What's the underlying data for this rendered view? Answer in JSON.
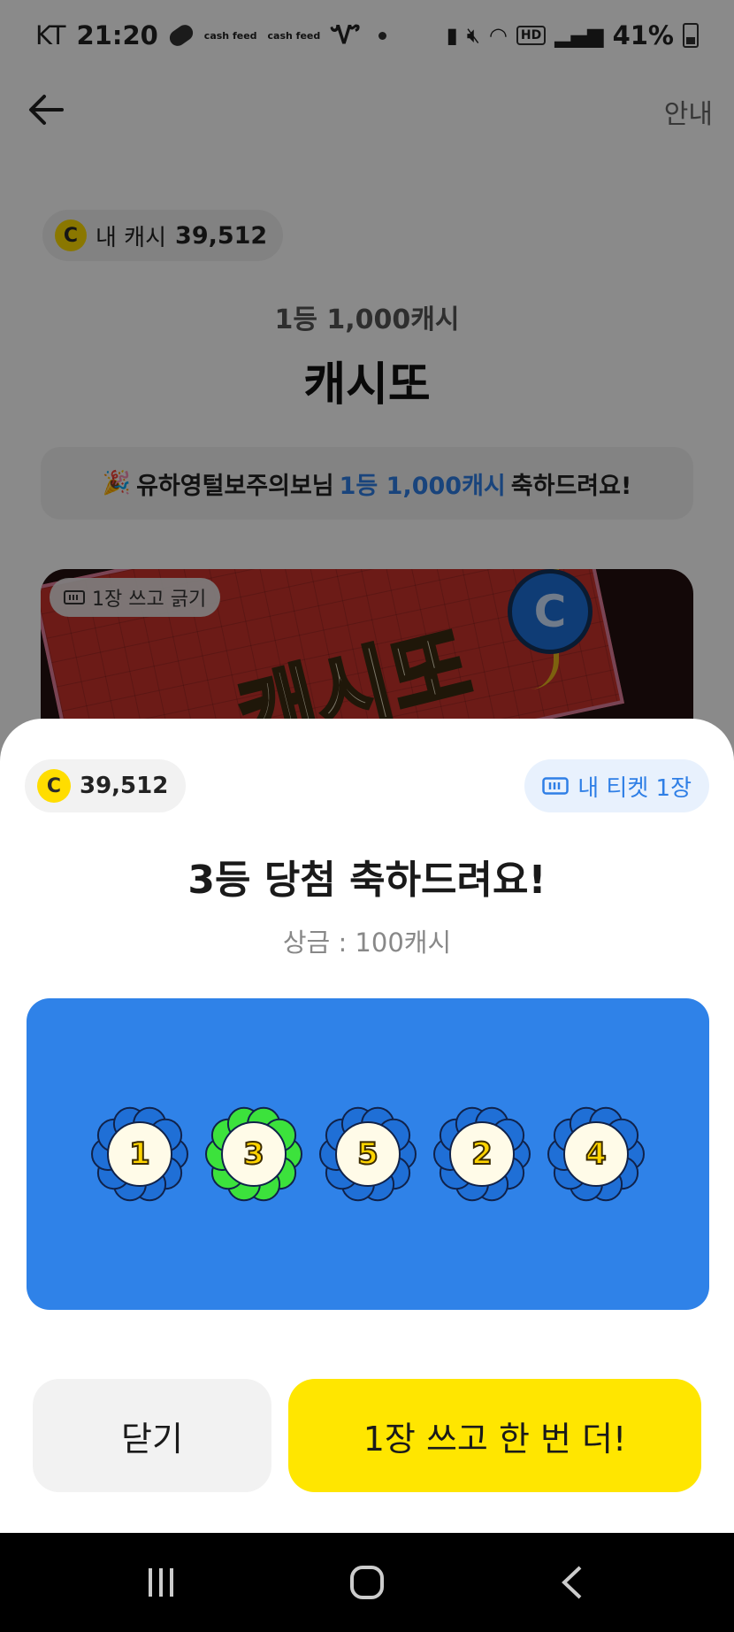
{
  "status_bar": {
    "carrier": "KT",
    "time": "21:20",
    "app_badges": [
      "cash feed",
      "cash feed"
    ],
    "battery": "41%"
  },
  "nav": {
    "info_label": "안내"
  },
  "my_cash": {
    "label": "내 캐시",
    "value": "39,512",
    "coin_letter": "C"
  },
  "game": {
    "top_prize": "1등 1,000캐시",
    "title": "캐시또"
  },
  "banner": {
    "user": "유하영털보주의보님",
    "prize": "1등 1,000캐시",
    "suffix": "축하드려요!"
  },
  "card": {
    "cost_label": "1장 쓰고 긁기",
    "art_text": "캐시또",
    "coin_letter": "C"
  },
  "sheet": {
    "balance": "39,512",
    "coin_letter": "C",
    "ticket_label": "내 티켓 1장",
    "result_title": "3등 당첨 축하드려요!",
    "prize_text": "상금 : 100캐시",
    "numbers": [
      {
        "value": "1",
        "matched": false
      },
      {
        "value": "3",
        "matched": true
      },
      {
        "value": "5",
        "matched": false
      },
      {
        "value": "2",
        "matched": false
      },
      {
        "value": "4",
        "matched": false
      }
    ],
    "close_label": "닫기",
    "again_label": "1장 쓰고 한 번 더!"
  },
  "colors": {
    "accent_blue": "#2f7fe6",
    "panel_blue": "#2f82e8",
    "yellow": "#ffe600",
    "flower_blue": "#1f6fd6",
    "flower_green": "#3ce23c"
  }
}
